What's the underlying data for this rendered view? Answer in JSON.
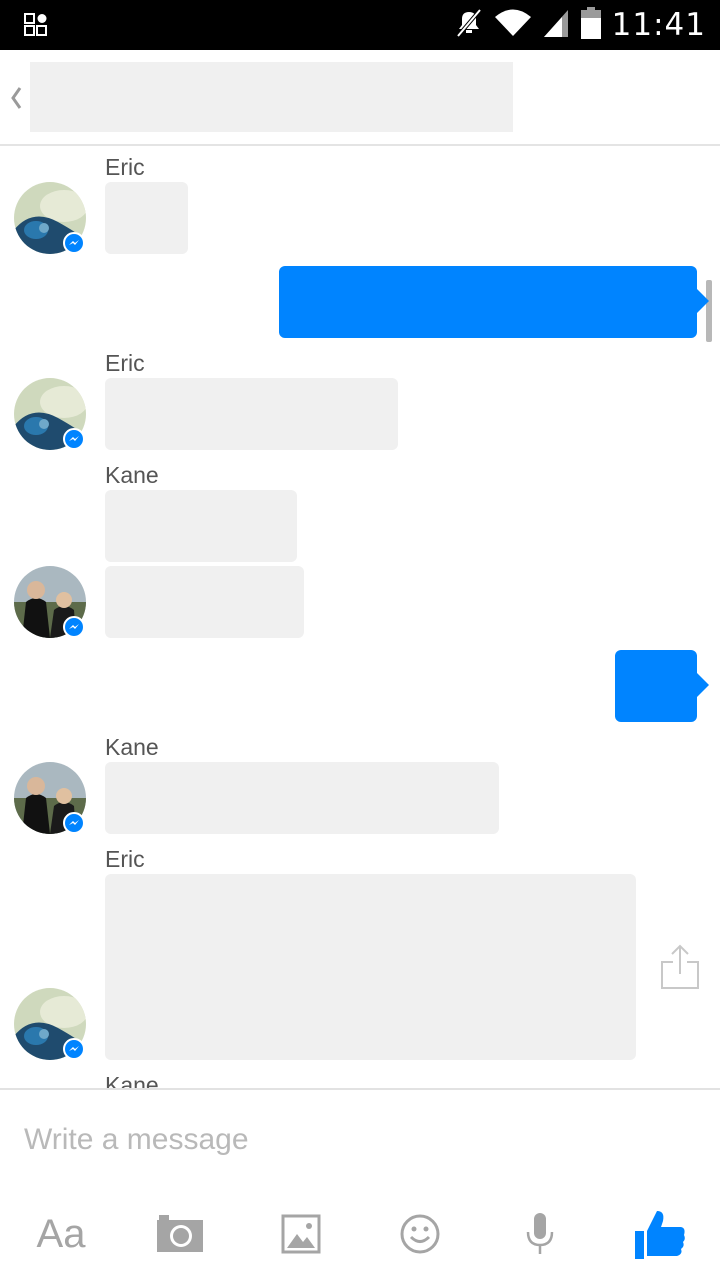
{
  "status_bar": {
    "time": "11:41",
    "icons": [
      "notifications-icon",
      "mute-icon",
      "wifi-icon",
      "signal-icon",
      "battery-icon"
    ]
  },
  "header": {
    "back_icon": "chevron-left-icon",
    "title": ""
  },
  "messages": [
    {
      "sender": "Eric",
      "direction": "incoming",
      "text": ""
    },
    {
      "sender": "",
      "direction": "outgoing",
      "text": ""
    },
    {
      "sender": "Eric",
      "direction": "incoming",
      "text": ""
    },
    {
      "sender": "Kane",
      "direction": "incoming",
      "text": ""
    },
    {
      "sender": "",
      "direction": "incoming",
      "text": ""
    },
    {
      "sender": "",
      "direction": "outgoing",
      "text": ""
    },
    {
      "sender": "Kane",
      "direction": "incoming",
      "text": ""
    },
    {
      "sender": "Eric",
      "direction": "incoming",
      "text": ""
    },
    {
      "sender": "Kane",
      "direction": "incoming",
      "text": ""
    }
  ],
  "composer": {
    "placeholder": "Write a message",
    "value": "",
    "tools": [
      {
        "name": "text-format",
        "label": "Aa"
      },
      {
        "name": "camera-icon"
      },
      {
        "name": "gallery-icon"
      },
      {
        "name": "emoji-icon"
      },
      {
        "name": "microphone-icon"
      },
      {
        "name": "like-icon"
      }
    ]
  },
  "colors": {
    "accent": "#0084ff",
    "incoming_bubble": "#f0f0f0",
    "icon_gray": "#a5a5a5",
    "sender_name": "#555555"
  }
}
